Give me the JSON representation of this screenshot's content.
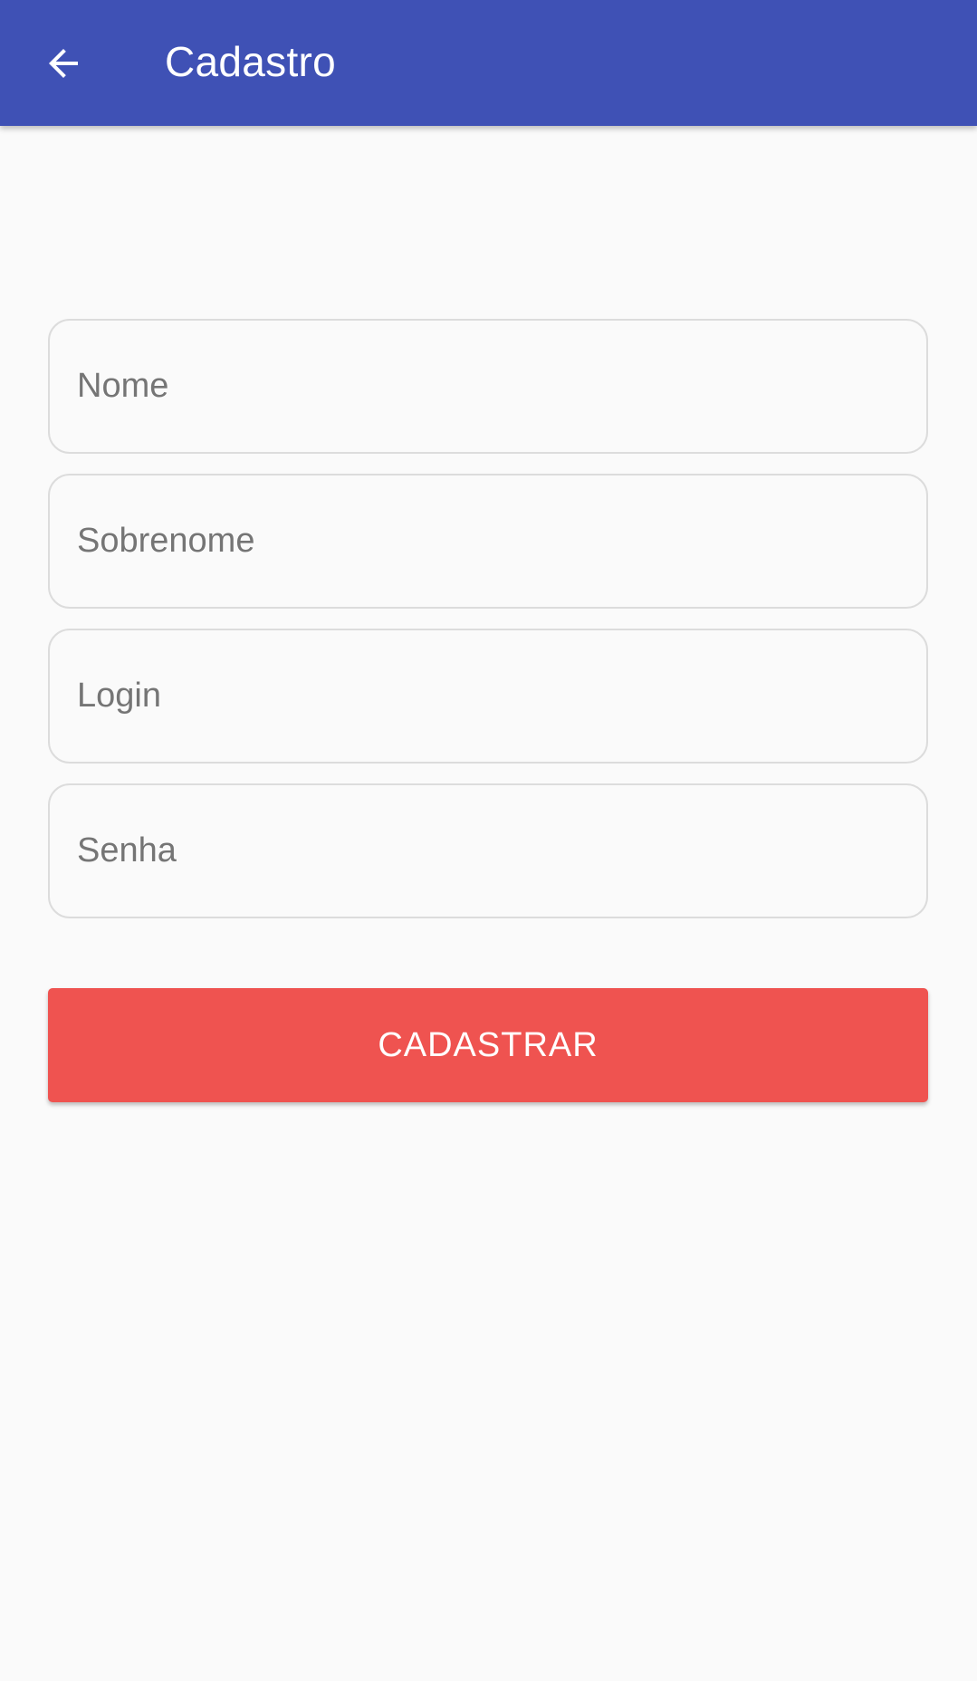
{
  "app_bar": {
    "title": "Cadastro",
    "back_icon": "arrow-left-icon",
    "background_color": "#3f51b5"
  },
  "form": {
    "fields": [
      {
        "placeholder": "Nome",
        "value": ""
      },
      {
        "placeholder": "Sobrenome",
        "value": ""
      },
      {
        "placeholder": "Login",
        "value": ""
      },
      {
        "placeholder": "Senha",
        "value": ""
      }
    ],
    "submit_label": "CADASTRAR",
    "submit_color": "#ef5350"
  }
}
